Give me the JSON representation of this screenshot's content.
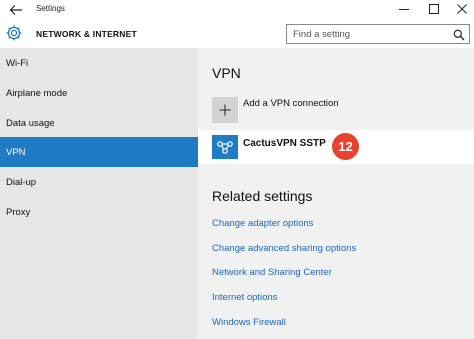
{
  "window": {
    "title": "Settings",
    "back_icon": "back-arrow-icon",
    "controls": [
      "minimize-icon",
      "maximize-icon",
      "close-icon"
    ]
  },
  "header": {
    "icon": "gear-icon",
    "title": "NETWORK & INTERNET",
    "search_placeholder": "Find a setting",
    "search_icon": "search-icon"
  },
  "sidebar": {
    "items": [
      {
        "label": "Wi-Fi",
        "active": false
      },
      {
        "label": "Airplane mode",
        "active": false
      },
      {
        "label": "Data usage",
        "active": false
      },
      {
        "label": "VPN",
        "active": true
      },
      {
        "label": "Dial-up",
        "active": false
      },
      {
        "label": "Proxy",
        "active": false
      }
    ]
  },
  "main": {
    "title": "VPN",
    "add_vpn_label": "Add a VPN connection",
    "connection": {
      "name": "CactusVPN SSTP",
      "icon": "vpn-connection-icon"
    },
    "step_badge": "12",
    "related_title": "Related settings",
    "related_links": [
      "Change adapter options",
      "Change advanced sharing options",
      "Network and Sharing Center",
      "Internet options",
      "Windows Firewall"
    ]
  },
  "colors": {
    "accent": "#1e7bc4",
    "sidebar_bg": "#e6e6e6",
    "main_bg": "#f1f1f1",
    "link": "#1a66b8",
    "badge": "#e8412c"
  }
}
